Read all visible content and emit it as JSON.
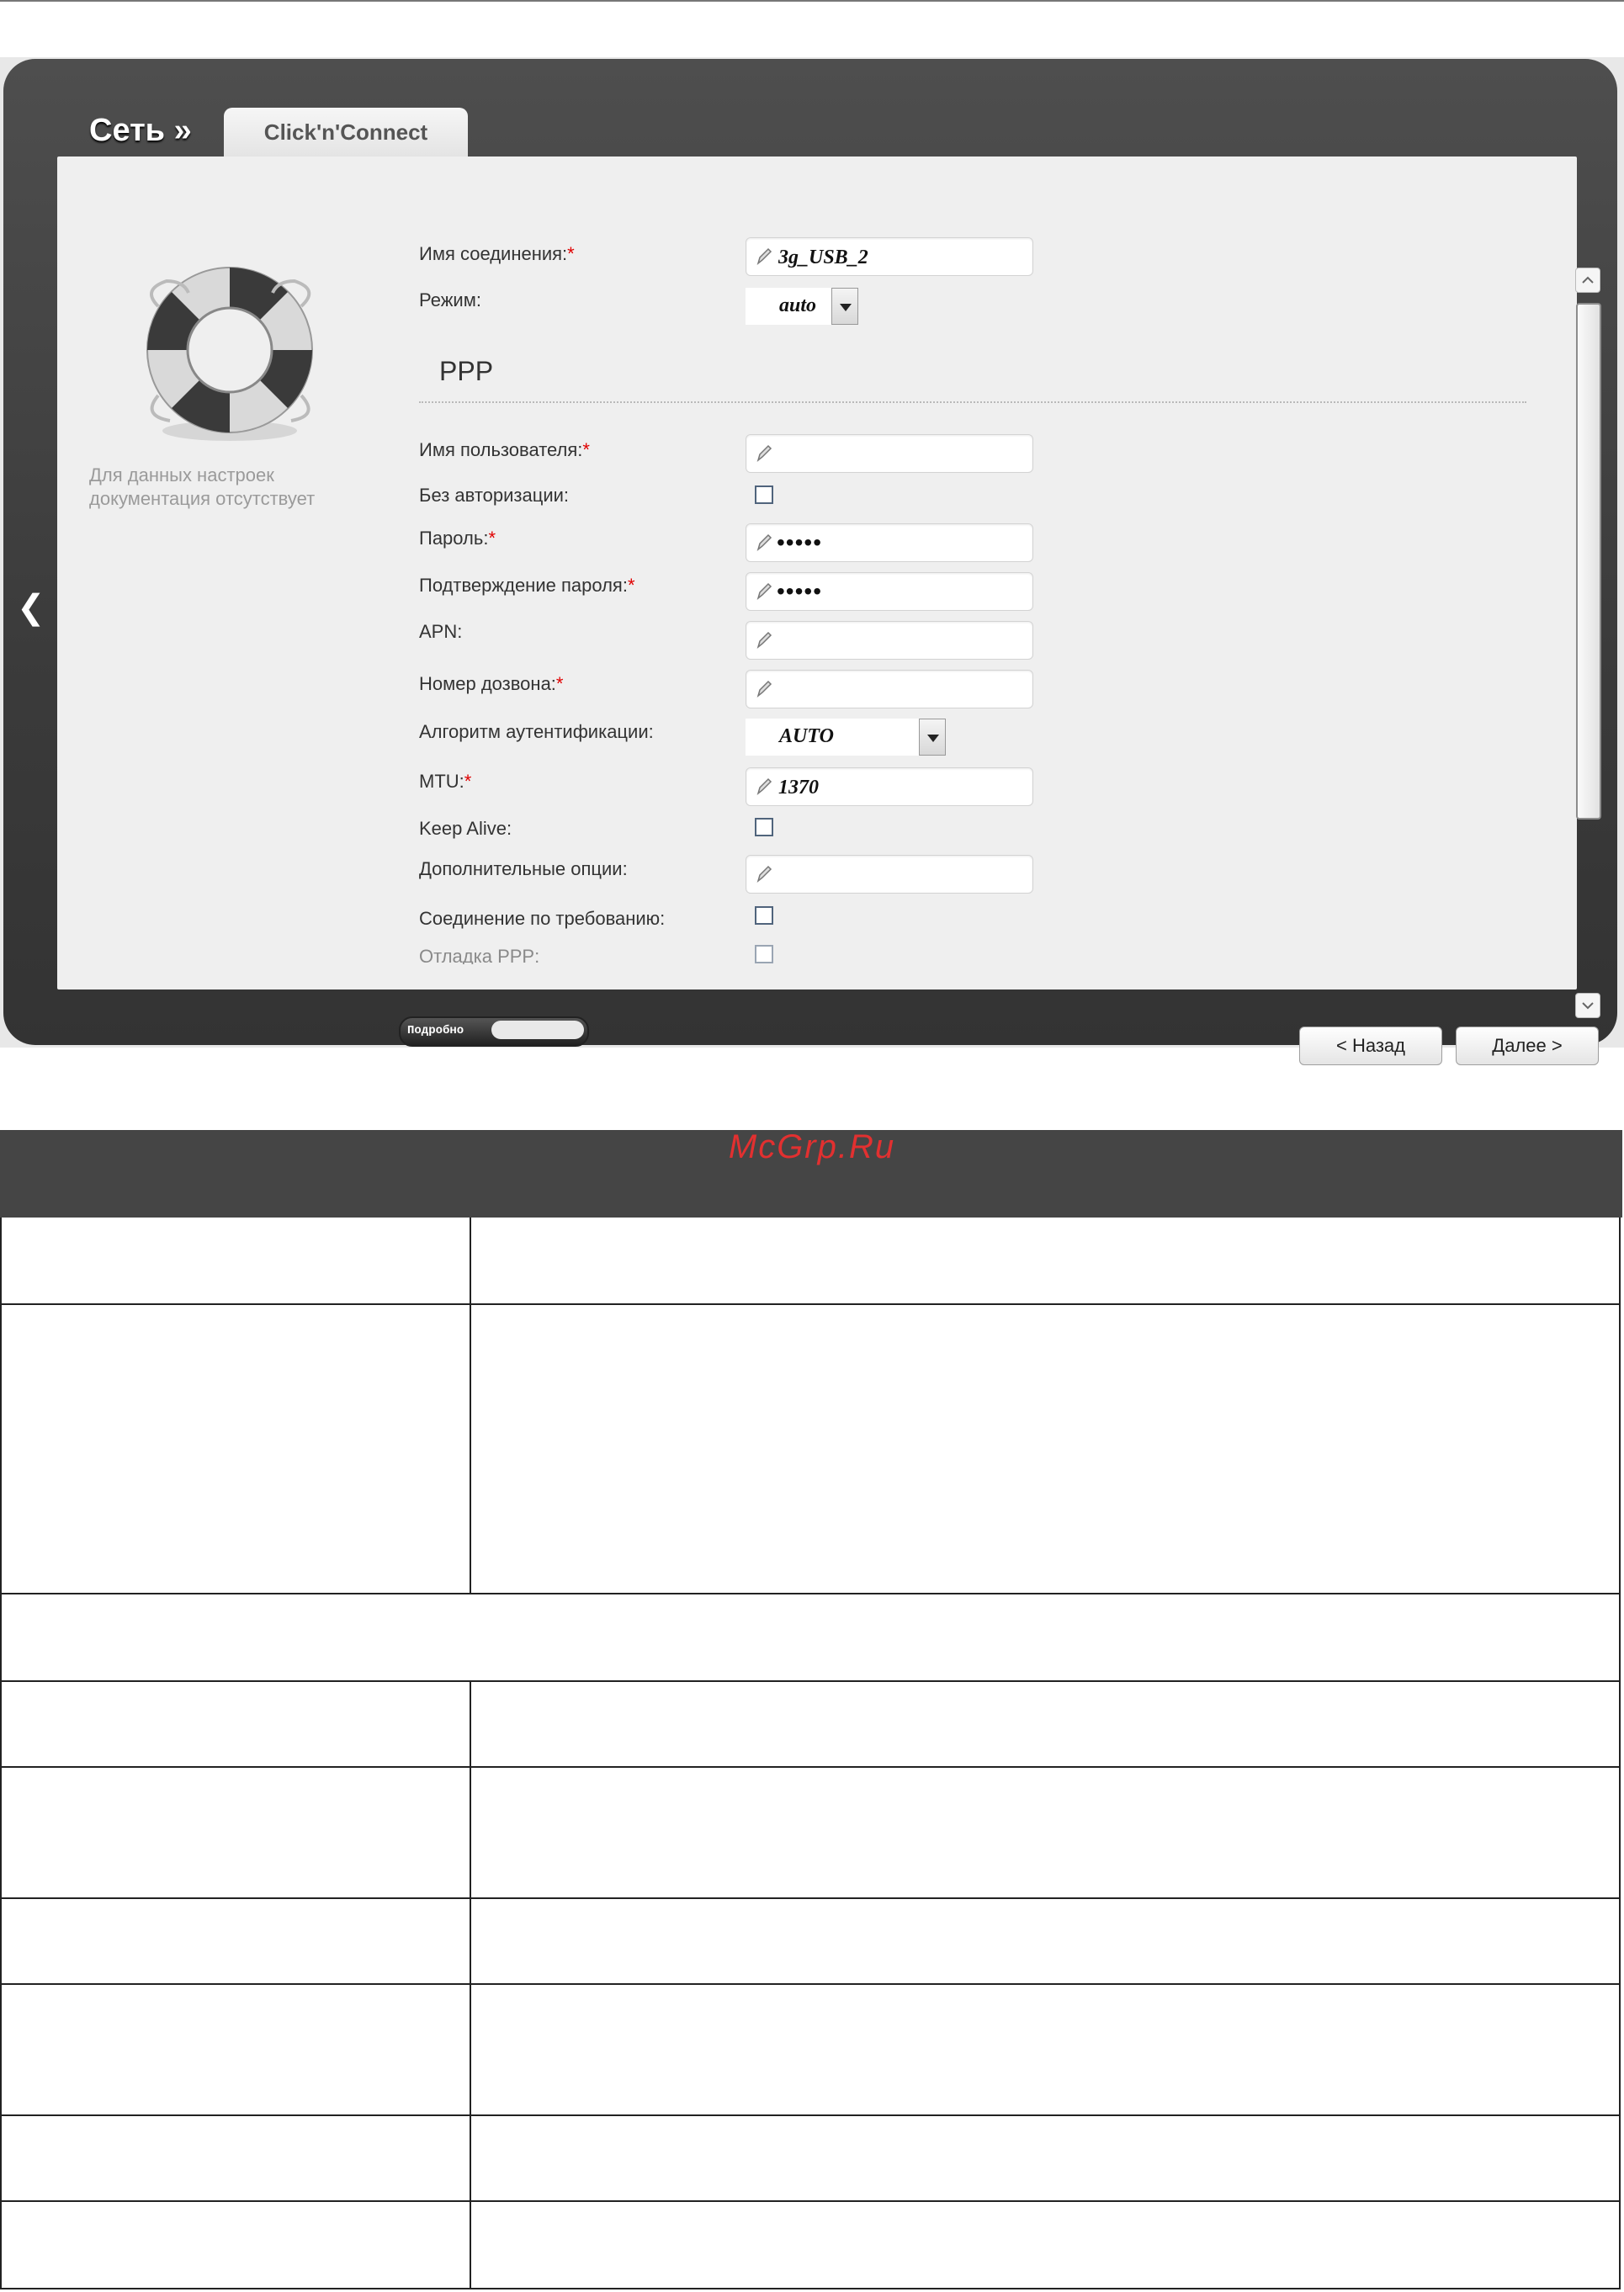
{
  "header": {
    "breadcrumb": "Сеть »",
    "tab": "Click'n'Connect"
  },
  "sidebar": {
    "no_docs": "Для данных настроек документация отсутствует"
  },
  "form": {
    "connection_name": {
      "label": "Имя соединения:",
      "value": "3g_USB_2"
    },
    "mode": {
      "label": "Режим:",
      "value": "auto"
    },
    "ppp_section": "PPP",
    "username": {
      "label": "Имя пользователя:",
      "value": ""
    },
    "no_auth": {
      "label": "Без авторизации:",
      "checked": false
    },
    "password": {
      "label": "Пароль:",
      "value": "•••••"
    },
    "password_confirm": {
      "label": "Подтверждение пароля:",
      "value": "•••••"
    },
    "apn": {
      "label": "APN:",
      "value": ""
    },
    "dial_number": {
      "label": "Номер дозвона:",
      "value": ""
    },
    "auth_algorithm": {
      "label": "Алгоритм аутентификации:",
      "value": "AUTO"
    },
    "mtu": {
      "label": "MTU:",
      "value": "1370"
    },
    "keep_alive": {
      "label": "Keep Alive:",
      "checked": false
    },
    "extra_options": {
      "label": "Дополнительные опции:",
      "value": ""
    },
    "on_demand": {
      "label": "Соединение по требованию:",
      "checked": false
    },
    "ppp_debug": {
      "label": "Отладка PPP:",
      "checked": false
    },
    "required_mark": "*"
  },
  "details_toggle": "Подробно",
  "buttons": {
    "back": "< Назад",
    "next": "Далее >"
  },
  "watermark": "McGrp.Ru"
}
